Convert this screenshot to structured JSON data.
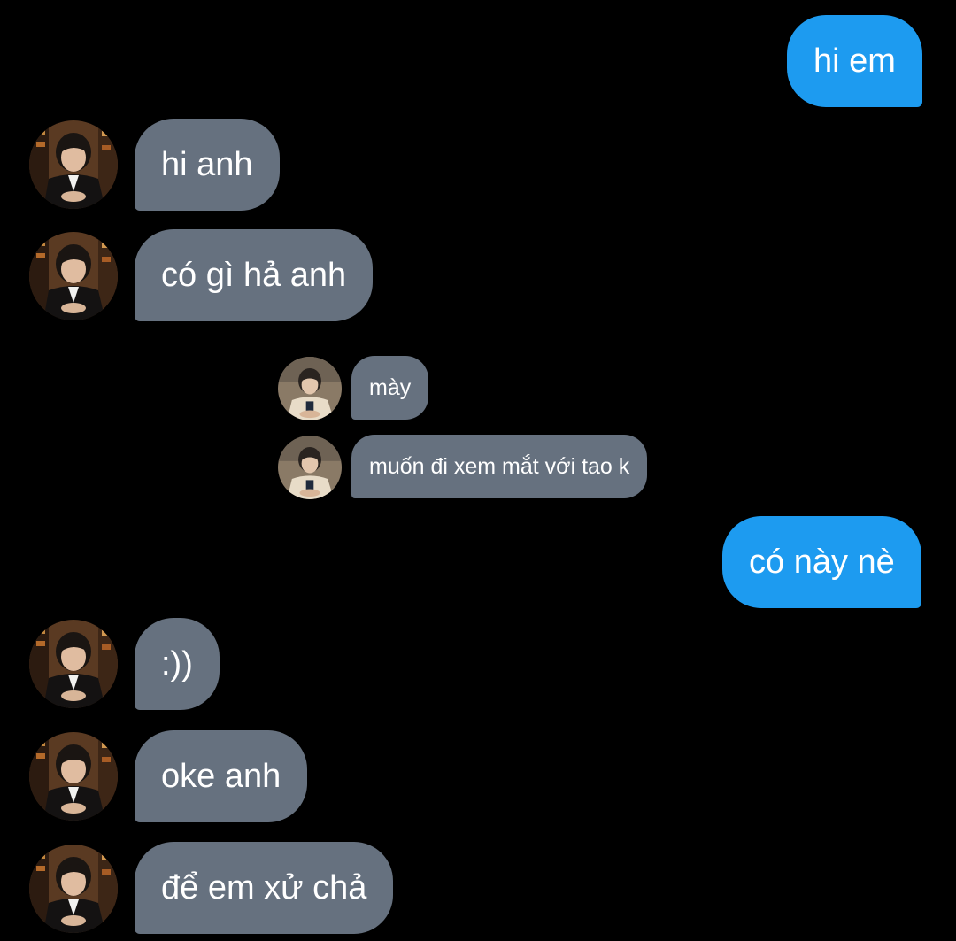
{
  "conversation": {
    "messages": [
      {
        "text": "hi em"
      },
      {
        "text": "hi anh"
      },
      {
        "text": "có gì hả anh"
      },
      {
        "text": "mày"
      },
      {
        "text": "muốn đi xem mắt với tao k"
      },
      {
        "text": "có này nè"
      },
      {
        "text": ":))"
      },
      {
        "text": "oke anh"
      },
      {
        "text": "để em xử chả"
      }
    ]
  },
  "colors": {
    "background": "#000000",
    "sent_bubble": "#1d9bf0",
    "received_bubble": "#66717f",
    "text": "#ffffff"
  },
  "icons": {
    "avatar": "avatar-photo",
    "quoted_avatar": "avatar-photo-light"
  }
}
